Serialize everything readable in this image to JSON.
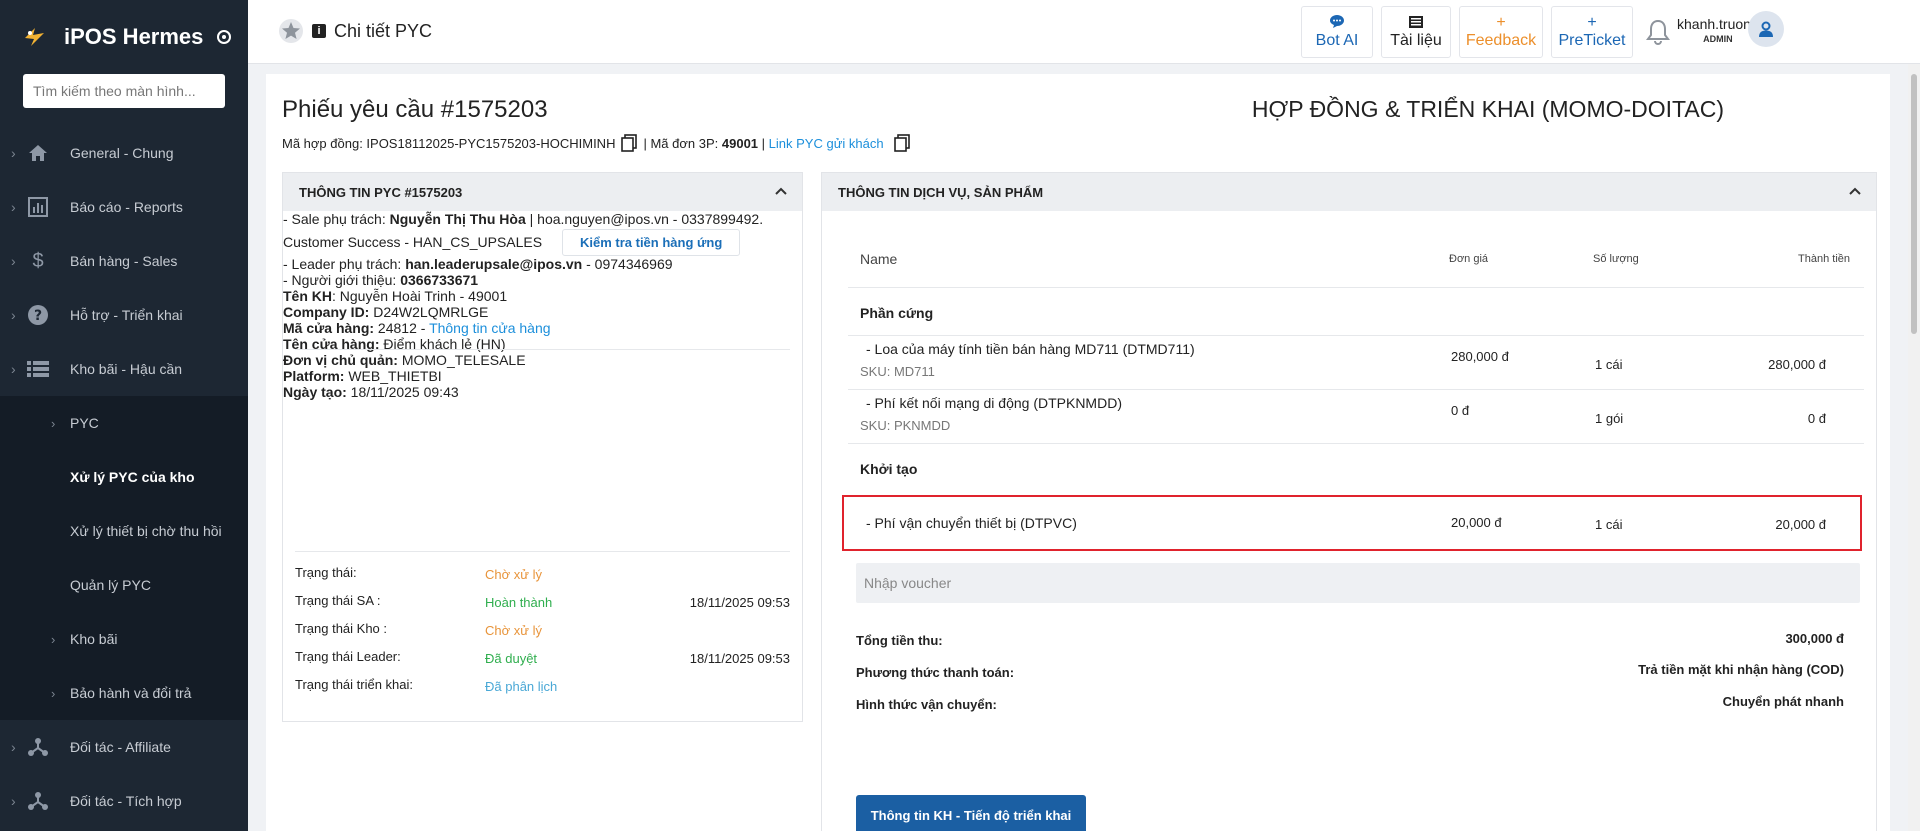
{
  "app": {
    "name": "iPOS Hermes"
  },
  "search": {
    "placeholder": "Tìm kiếm theo màn hình..."
  },
  "sidebar": {
    "items": [
      {
        "label": "General - Chung",
        "icon": "home-icon"
      },
      {
        "label": "Báo cáo - Reports",
        "icon": "bar-chart-icon"
      },
      {
        "label": "Bán hàng - Sales",
        "icon": "dollar-icon"
      },
      {
        "label": "Hỗ trợ - Triển khai",
        "icon": "help-circle-icon"
      },
      {
        "label": "Kho bãi - Hậu cần",
        "icon": "list-icon"
      }
    ],
    "sub_items": [
      {
        "label": "PYC"
      },
      {
        "label": "Xử lý PYC của kho"
      },
      {
        "label": "Xử lý thiết bị chờ thu hồi"
      },
      {
        "label": "Quản lý PYC"
      },
      {
        "label": "Kho bãi"
      },
      {
        "label": "Bảo hành và đổi trả"
      }
    ],
    "bottom_items": [
      {
        "label": "Đối tác - Affiliate",
        "icon": "share-icon"
      },
      {
        "label": "Đối tác - Tích hợp",
        "icon": "share-icon"
      }
    ]
  },
  "topbar": {
    "breadcrumb": "Chi tiết PYC",
    "buttons": {
      "bot": "Bot AI",
      "docs": "Tài liệu",
      "feedback": "Feedback",
      "preticket": "PreTicket",
      "plus": "+"
    },
    "user": {
      "name": "khanh.truong",
      "role": "ADMIN"
    }
  },
  "page": {
    "title": "Phiếu yêu cầu #1575203",
    "right_title": "HỢP ĐỒNG & TRIỂN KHAI (MOMO-DOITAC)",
    "contract_label": "Mã hợp đồng: IPOS18112025-PYC1575203-HOCHIMINH",
    "order3p_label": "| Mã đơn 3P:",
    "order3p_value": "49001",
    "sep": "|",
    "link_label": "Link PYC gửi khách"
  },
  "left_panel": {
    "header": "THÔNG TIN PYC #1575203",
    "sale_prefix": "- Sale phụ trách:",
    "sale_name": "Nguyễn Thị Thu Hòa",
    "sale_contact": "| hoa.nguyen@ipos.vn - 0337899492.",
    "cs_label": "Customer Success - HAN_CS_UPSALES",
    "cs_button": "Kiểm tra tiền hàng ứng",
    "leader_prefix": "- Leader phụ trách:",
    "leader_email": "han.leaderupsale@ipos.vn",
    "leader_phone": "- 0974346969",
    "ref_prefix": "- Người giới thiệu:",
    "ref_phone": "0366733671",
    "customer": [
      {
        "k": "Tên KH",
        "sep": ":",
        "v": " Nguyễn Hoài Trinh - 49001"
      },
      {
        "k": "Company ID:",
        "sep": "",
        "v": " D24W2LQMRLGE"
      },
      {
        "k": "Mã cửa hàng:",
        "sep": "",
        "v": " 24812 -",
        "link": "Thông tin cửa hàng"
      },
      {
        "k": "Tên cửa hàng:",
        "sep": "",
        "v": " Điểm khách lẻ (HN)"
      },
      {
        "k": "Đơn vị chủ quản:",
        "sep": "",
        "v": " MOMO_TELESALE"
      },
      {
        "k": "Platform:",
        "sep": "",
        "v": " WEB_THIETBI"
      },
      {
        "k": "Ngày tạo:",
        "sep": "",
        "v": " 18/11/2025 09:43"
      }
    ],
    "statuses": [
      {
        "label": "Trạng thái:",
        "value": "Chờ xử lý",
        "color": "#e8943a",
        "date": ""
      },
      {
        "label": "Trạng thái SA :",
        "value": "Hoàn thành",
        "color": "#2fae4e",
        "date": "18/11/2025 09:53"
      },
      {
        "label": "Trạng thái Kho :",
        "value": "Chờ xử lý",
        "color": "#e8943a",
        "date": ""
      },
      {
        "label": "Trạng thái Leader:",
        "value": "Đã duyệt",
        "color": "#2fae4e",
        "date": "18/11/2025 09:53"
      },
      {
        "label": "Trạng thái triển khai:",
        "value": "Đã phân lịch",
        "color": "#4aa8d6",
        "date": ""
      }
    ]
  },
  "right_panel": {
    "header": "THÔNG TIN DỊCH VỤ, SẢN PHẨM",
    "columns": {
      "name": "Name",
      "price": "Đơn giá",
      "qty": "Số lượng",
      "total": "Thành tiền"
    },
    "sections": [
      {
        "title": "Phần cứng",
        "items": [
          {
            "name": "- Loa của máy tính tiền bán hàng MD711 (DTMD711)",
            "sku": "SKU: MD711",
            "price": "280,000 đ",
            "qty": "1 cái",
            "total": "280,000 đ"
          },
          {
            "name": "- Phí kết nối mạng di động (DTPKNMDD)",
            "sku": "SKU: PKNMDD",
            "price": "0 đ",
            "qty": "1 gói",
            "total": "0 đ"
          }
        ]
      },
      {
        "title": "Khởi tạo",
        "items": [
          {
            "name": "- Phí vận chuyển thiết bị (DTPVC)",
            "sku": "",
            "price": "20,000 đ",
            "qty": "1 cái",
            "total": "20,000 đ"
          }
        ]
      }
    ],
    "voucher_placeholder": "Nhập voucher",
    "summary": [
      {
        "label": "Tổng tiền thu:",
        "value": "300,000 đ"
      },
      {
        "label": "Phương thức thanh toán:",
        "value": "Trả tiền mặt khi nhận hàng (COD)"
      },
      {
        "label": "Hình thức vận chuyển:",
        "value": "Chuyển phát nhanh"
      }
    ],
    "action_button": "Thông tin KH - Tiến độ triển khai"
  },
  "colors": {
    "sidebar_bg": "#1d2733",
    "primary": "#1b5fa3",
    "link": "#1c8fdb",
    "feedback": "#ec8f2b",
    "highlight": "#e0232d"
  }
}
